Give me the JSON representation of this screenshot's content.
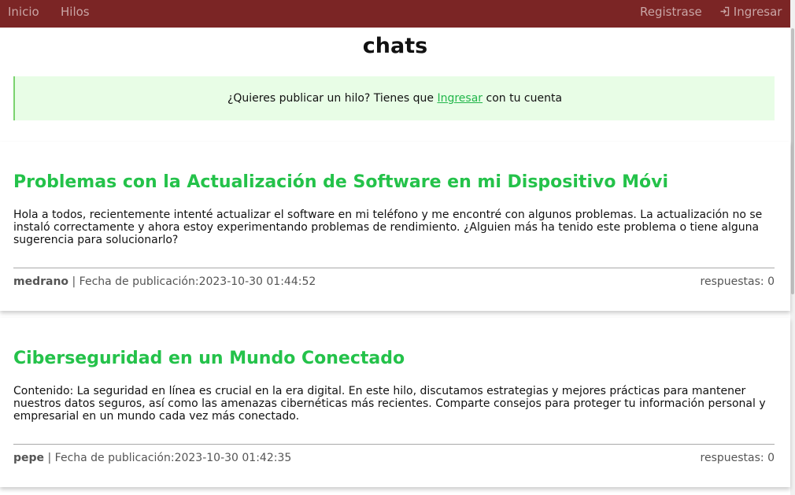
{
  "nav": {
    "home": "Inicio",
    "threads": "Hilos",
    "register": "Registrase",
    "login_icon": "login-icon",
    "login": "Ingresar"
  },
  "page": {
    "title": "chats"
  },
  "alert": {
    "text_before": "¿Quieres publicar un hilo? Tienes que",
    "link": "Ingresar",
    "text_after": "con tu cuenta"
  },
  "threads": [
    {
      "title": "Problemas con la Actualización de Software en mi Dispositivo Móvi",
      "body": "Hola a todos, recientemente intenté actualizar el software en mi teléfono y me encontré con algunos problemas. La actualización no se instaló correctamente y ahora estoy experimentando problemas de rendimiento. ¿Alguien más ha tenido este problema o tiene alguna sugerencia para solucionarlo?",
      "author": "medrano",
      "separator": "|",
      "date_label": "Fecha de publicación:",
      "date": "2023-10-30 01:44:52",
      "replies": "respuestas: 0"
    },
    {
      "title": "Ciberseguridad en un Mundo Conectado",
      "body": "Contenido: La seguridad en línea es crucial en la era digital. En este hilo, discutamos estrategias y mejores prácticas para mantener nuestros datos seguros, así como las amenazas cibernéticas más recientes. Comparte consejos para proteger tu información personal y empresarial en un mundo cada vez más conectado.",
      "author": "pepe",
      "separator": "|",
      "date_label": "Fecha de publicación:",
      "date": "2023-10-30 01:42:35",
      "replies": "respuestas: 0"
    }
  ]
}
